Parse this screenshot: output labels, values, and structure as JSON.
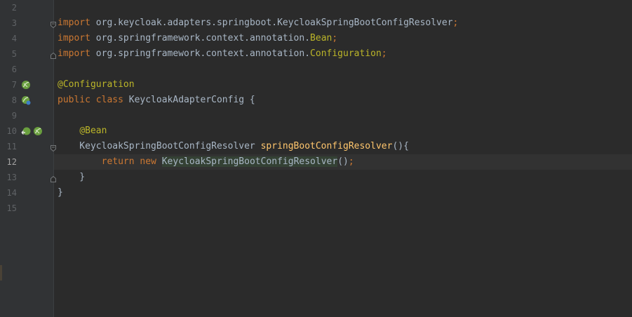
{
  "editor": {
    "current_line": "12",
    "lines": [
      {
        "number": "2",
        "segments": []
      },
      {
        "number": "3",
        "segments": [
          {
            "text": "import",
            "style": "kw"
          },
          {
            "text": " org.keycloak.adapters.springboot.KeycloakSpringBootConfigResolver",
            "style": "plain"
          },
          {
            "text": ";",
            "style": "kw"
          }
        ]
      },
      {
        "number": "4",
        "segments": [
          {
            "text": "import",
            "style": "kw"
          },
          {
            "text": " org.springframework.context.annotation.",
            "style": "plain"
          },
          {
            "text": "Bean",
            "style": "ann"
          },
          {
            "text": ";",
            "style": "kw"
          }
        ]
      },
      {
        "number": "5",
        "segments": [
          {
            "text": "import",
            "style": "kw"
          },
          {
            "text": " org.springframework.context.annotation.",
            "style": "plain"
          },
          {
            "text": "Configuration",
            "style": "ann"
          },
          {
            "text": ";",
            "style": "kw"
          }
        ]
      },
      {
        "number": "6",
        "segments": []
      },
      {
        "number": "7",
        "segments": [
          {
            "text": "@Configuration",
            "style": "ann"
          }
        ]
      },
      {
        "number": "8",
        "segments": [
          {
            "text": "public class",
            "style": "kw"
          },
          {
            "text": " KeycloakAdapterConfig {",
            "style": "plain"
          }
        ]
      },
      {
        "number": "9",
        "segments": []
      },
      {
        "number": "10",
        "segments": [
          {
            "text": "    ",
            "style": "plain"
          },
          {
            "text": "@Bean",
            "style": "ann"
          }
        ]
      },
      {
        "number": "11",
        "segments": [
          {
            "text": "    KeycloakSpringBootConfigResolver ",
            "style": "plain"
          },
          {
            "text": "springBootConfigResolver",
            "style": "fn"
          },
          {
            "text": "(){",
            "style": "plain"
          }
        ]
      },
      {
        "number": "12",
        "segments": [
          {
            "text": "        ",
            "style": "plain"
          },
          {
            "text": "return new",
            "style": "kw"
          },
          {
            "text": " ",
            "style": "plain"
          },
          {
            "text": "KeycloakSpringBootConfigResolver",
            "style": "hl"
          },
          {
            "text": "()",
            "style": "plain"
          },
          {
            "text": ";",
            "style": "kw"
          }
        ]
      },
      {
        "number": "13",
        "segments": [
          {
            "text": "    }",
            "style": "plain"
          }
        ]
      },
      {
        "number": "14",
        "segments": [
          {
            "text": "}",
            "style": "plain"
          }
        ]
      },
      {
        "number": "15",
        "segments": []
      }
    ],
    "gutter_icons": [
      {
        "line": "7",
        "name": "spring-bean-icon"
      },
      {
        "line": "8",
        "name": "spring-config-icon"
      },
      {
        "line": "10",
        "name": "navigate-back-icon"
      },
      {
        "line": "10",
        "name": "spring-bean-icon"
      }
    ],
    "fold_markers": [
      {
        "line": "3",
        "kind": "start"
      },
      {
        "line": "5",
        "kind": "end"
      },
      {
        "line": "11",
        "kind": "start"
      },
      {
        "line": "13",
        "kind": "end"
      }
    ]
  },
  "colors": {
    "background": "#2b2b2b",
    "gutter": "#313335",
    "keyword": "#cc7832",
    "annotation": "#bbb529",
    "method": "#ffc66d",
    "plain": "#a9b7c6",
    "line_number": "#606366",
    "caret_row": "#323232",
    "usage_highlight": "#344134",
    "spring_icon": "#6a9f3f"
  }
}
